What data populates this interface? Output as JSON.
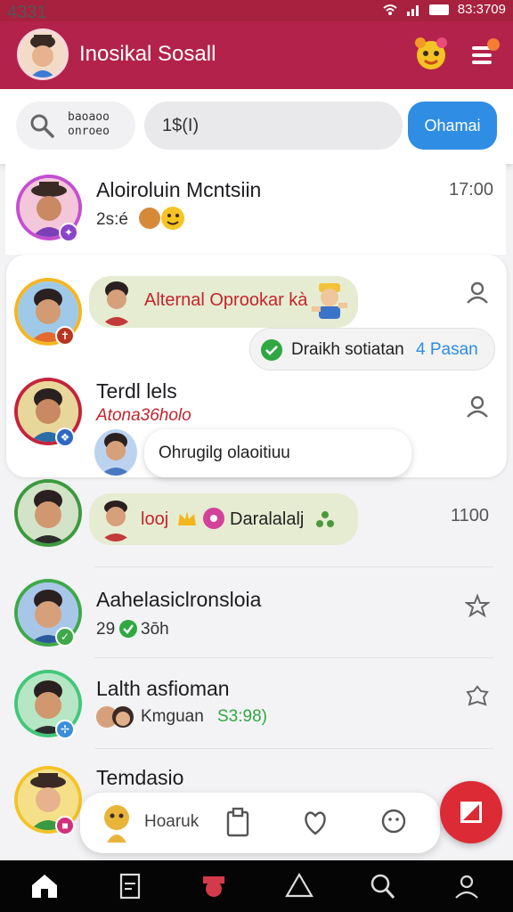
{
  "status_bar": {
    "time": "4331",
    "clock": "83:3709"
  },
  "header": {
    "title": "Inosikal Sosall"
  },
  "search": {
    "label_line1": "baoaoo",
    "label_line2": "onroeo",
    "input_value": "1$(I)",
    "button_label": "Ohamai"
  },
  "items": [
    {
      "name": "Aloiroluin Mcntsiin",
      "subtitle": "2s:é",
      "time": "17:00"
    },
    {
      "bubble_text": "Alternal Oprookar kà",
      "reply_text": "Draikh sotiatan",
      "reply_link": "4 Pasan"
    },
    {
      "name": "Terdl lels",
      "subtitle": "Atona36holo",
      "popup_text": "Ohrugilg olaoitiuu"
    },
    {
      "bubble_part1": "looj",
      "bubble_part2": "Daralalalj",
      "time": "1100"
    },
    {
      "name": "Aahelasiclronsloia",
      "subtitle_num": "29",
      "subtitle_tail": "3ōh"
    },
    {
      "name": "Lalth asfioman",
      "subtitle": "Kmguan",
      "subtitle_accent": "S3:98)"
    },
    {
      "name": "Temdasio"
    }
  ],
  "floating_bar": {
    "label": "Hoaruk"
  },
  "colors": {
    "header": "#b3224a",
    "accent_blue": "#2f8de4",
    "accent_green": "#2fa843",
    "fab": "#dd2b36"
  }
}
